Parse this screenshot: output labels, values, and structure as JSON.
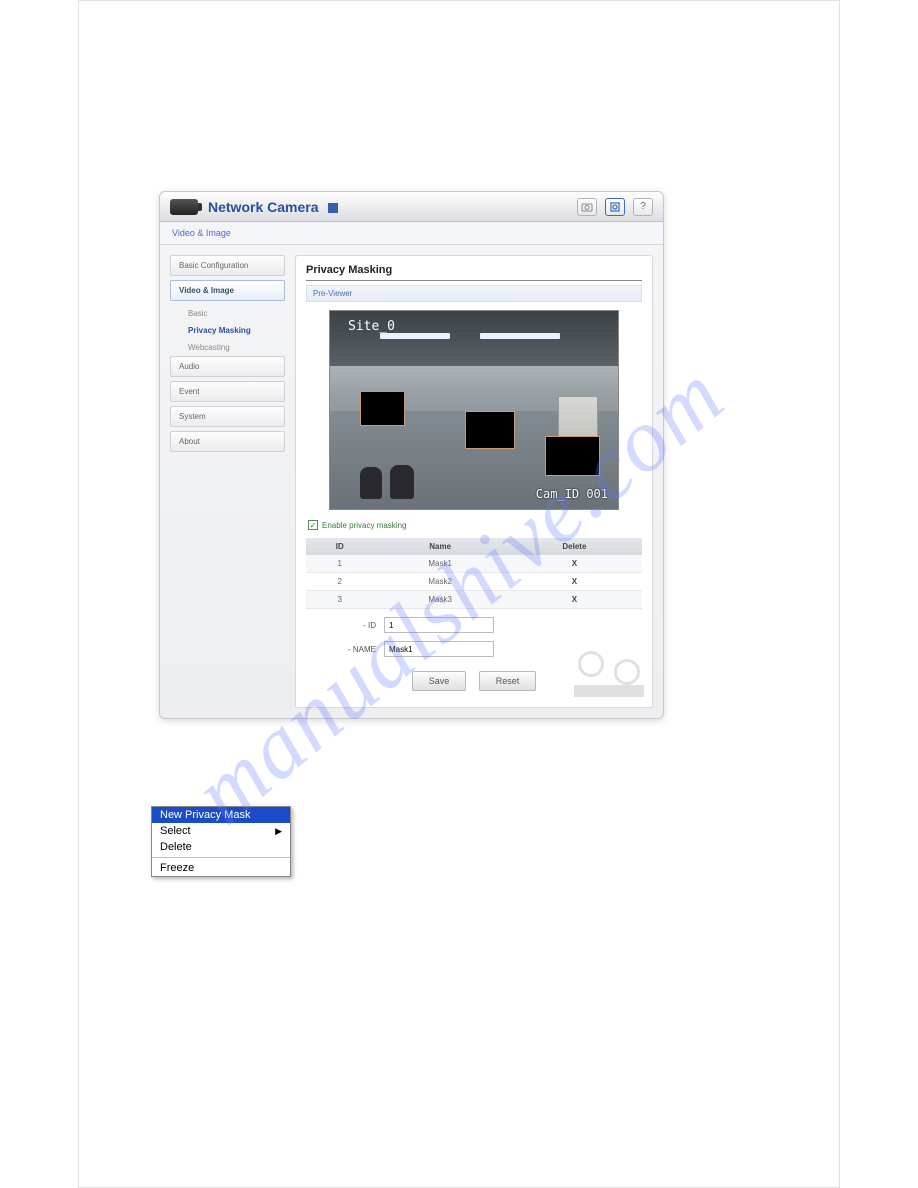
{
  "header": {
    "title": "Network Camera"
  },
  "breadcrumb": "Video & Image",
  "sidebar": {
    "sections": [
      {
        "label": "Basic Configuration"
      },
      {
        "label": "Video & Image"
      },
      {
        "label": "Audio"
      },
      {
        "label": "Event"
      },
      {
        "label": "System"
      },
      {
        "label": "About"
      }
    ],
    "videoImageSub": [
      {
        "label": "Basic"
      },
      {
        "label": "Privacy Masking"
      },
      {
        "label": "Webcasting"
      }
    ]
  },
  "panel": {
    "title": "Privacy Masking",
    "subheader": "Pre-Viewer",
    "siteLabel": "Site_0",
    "camLabel": "Cam_ID 001",
    "checkboxLabel": "Enable privacy masking",
    "checkboxChecked": true,
    "tableHeaders": {
      "id": "ID",
      "name": "Name",
      "delete": "Delete"
    },
    "masks": [
      {
        "id": "1",
        "name": "Mask1"
      },
      {
        "id": "2",
        "name": "Mask2"
      },
      {
        "id": "3",
        "name": "Mask3"
      }
    ],
    "fields": {
      "idLabel": "- ID",
      "idValue": "1",
      "nameLabel": "- NAME",
      "nameValue": "Mask1"
    },
    "buttons": {
      "save": "Save",
      "reset": "Reset"
    }
  },
  "contextMenu": {
    "items": [
      {
        "label": "New Privacy Mask",
        "selected": true
      },
      {
        "label": "Select",
        "submenu": true
      },
      {
        "label": "Delete"
      }
    ],
    "separatorAfter": 2,
    "extra": [
      {
        "label": "Freeze"
      }
    ]
  },
  "watermark": "manualshive.com"
}
